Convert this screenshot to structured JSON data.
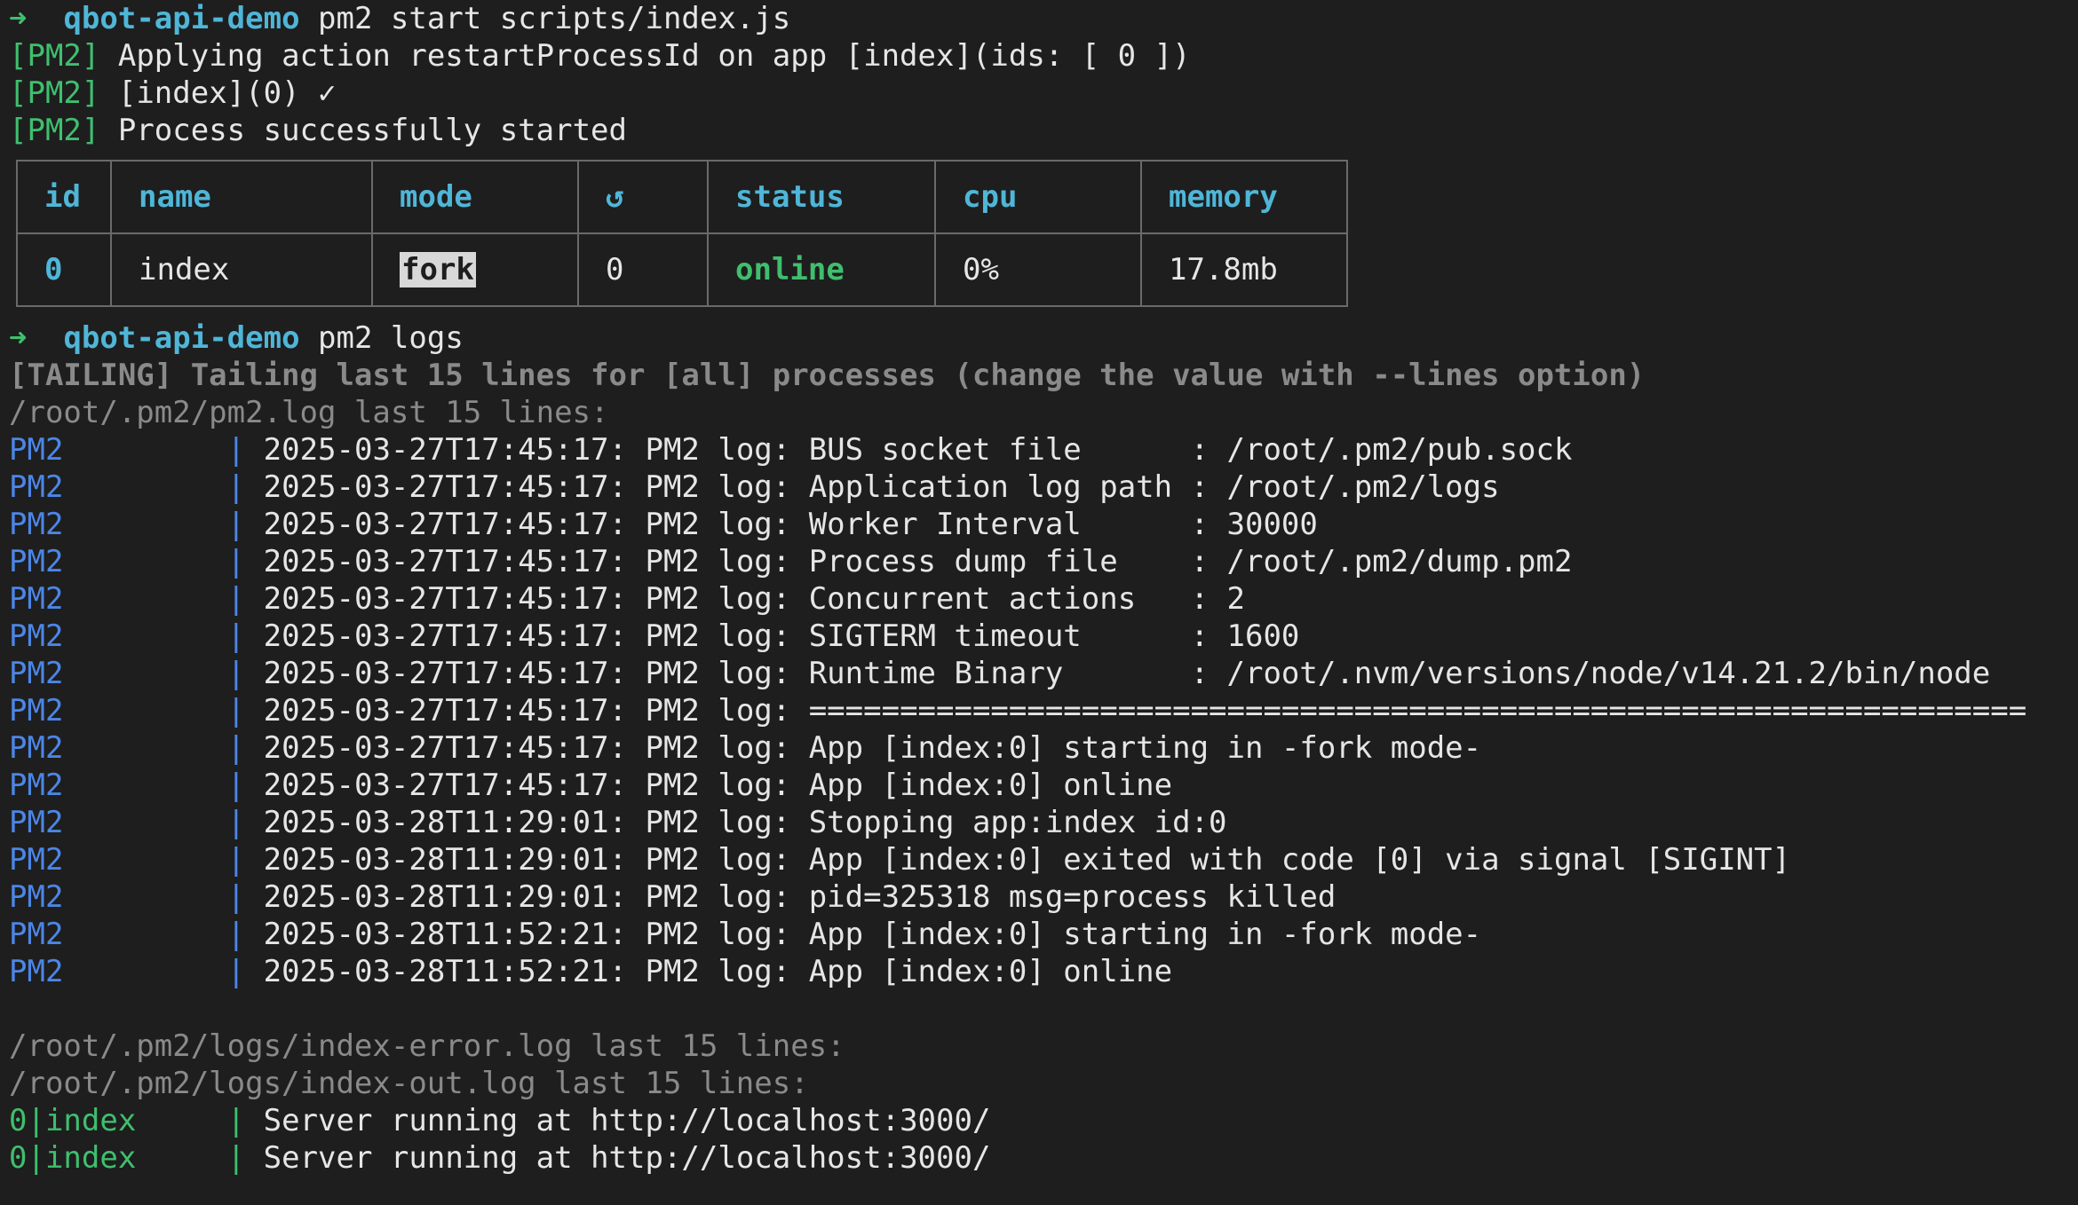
{
  "prompt": {
    "arrow": "➜",
    "dir": "qbot-api-demo"
  },
  "commands": {
    "start": "pm2 start scripts/index.js",
    "logs": "pm2 logs"
  },
  "start_output": [
    {
      "tag": "[PM2]",
      "text": "Applying action restartProcessId on app [index](ids: [ 0 ])"
    },
    {
      "tag": "[PM2]",
      "text": "[index](0) ✓"
    },
    {
      "tag": "[PM2]",
      "text": "Process successfully started"
    }
  ],
  "table": {
    "headers": [
      "id",
      "name",
      "mode",
      "↺",
      "status",
      "cpu",
      "memory"
    ],
    "row": {
      "id": "0",
      "name": "index",
      "mode": "fork",
      "restarts": "0",
      "status": "online",
      "cpu": "0%",
      "memory": "17.8mb"
    }
  },
  "logs_output": {
    "tailing": "[TAILING] Tailing last 15 lines for [all] processes (change the value with --lines option)",
    "pm2_log_header": "/root/.pm2/pm2.log last 15 lines:",
    "pm2_lines": [
      "2025-03-27T17:45:17: PM2 log: BUS socket file      : /root/.pm2/pub.sock",
      "2025-03-27T17:45:17: PM2 log: Application log path : /root/.pm2/logs",
      "2025-03-27T17:45:17: PM2 log: Worker Interval      : 30000",
      "2025-03-27T17:45:17: PM2 log: Process dump file    : /root/.pm2/dump.pm2",
      "2025-03-27T17:45:17: PM2 log: Concurrent actions   : 2",
      "2025-03-27T17:45:17: PM2 log: SIGTERM timeout      : 1600",
      "2025-03-27T17:45:17: PM2 log: Runtime Binary       : /root/.nvm/versions/node/v14.21.2/bin/node",
      "2025-03-27T17:45:17: PM2 log: ===================================================================",
      "2025-03-27T17:45:17: PM2 log: App [index:0] starting in -fork mode-",
      "2025-03-27T17:45:17: PM2 log: App [index:0] online",
      "2025-03-28T11:29:01: PM2 log: Stopping app:index id:0",
      "2025-03-28T11:29:01: PM2 log: App [index:0] exited with code [0] via signal [SIGINT]",
      "2025-03-28T11:29:01: PM2 log: pid=325318 msg=process killed",
      "2025-03-28T11:52:21: PM2 log: App [index:0] starting in -fork mode-",
      "2025-03-28T11:52:21: PM2 log: App [index:0] online"
    ],
    "pm2_label": "PM2",
    "error_log_header": "/root/.pm2/logs/index-error.log last 15 lines:",
    "out_log_header": "/root/.pm2/logs/index-out.log last 15 lines:",
    "out_label": "0|index",
    "out_lines": [
      "Server running at http://localhost:3000/",
      "Server running at http://localhost:3000/"
    ]
  },
  "colors": {
    "background": "#1e1e1e",
    "prompt_arrow": "#3fbf6e",
    "prompt_dir": "#4fb6d8",
    "pm2_label": "#4c86e6",
    "status_online": "#3fbf6e",
    "dim_text": "#8a8a8a"
  }
}
